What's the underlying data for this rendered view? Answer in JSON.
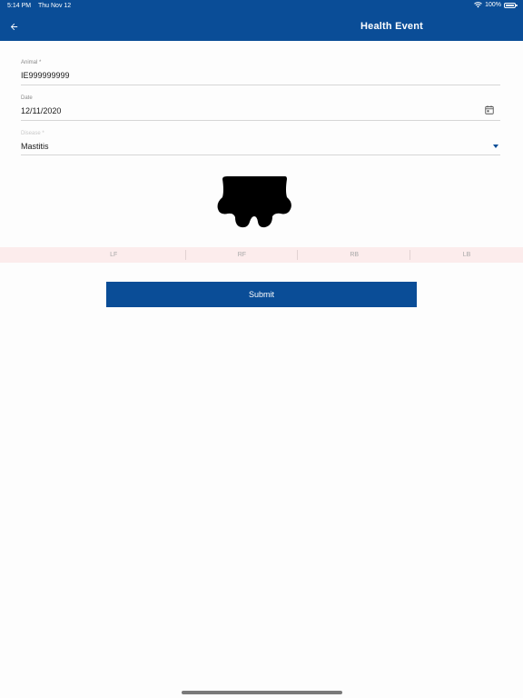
{
  "status_bar": {
    "time": "5:14 PM",
    "date": "Thu Nov 12",
    "battery": "100%",
    "wifi_icon": "wifi-icon",
    "battery_icon": "battery-icon"
  },
  "app_bar": {
    "title": "Health Event",
    "back_icon": "arrow-left-icon",
    "background_color": "#0a4d97"
  },
  "form": {
    "animal": {
      "label": "Animal *",
      "value": "IE999999999"
    },
    "date": {
      "label": "Date",
      "value": "12/11/2020",
      "icon": "calendar-icon"
    },
    "disease": {
      "label": "Disease *",
      "value": "Mastitis",
      "icon": "dropdown-arrow-icon"
    }
  },
  "udder": {
    "icon": "udder-icon"
  },
  "quarters": [
    {
      "label": "LF"
    },
    {
      "label": "RF"
    },
    {
      "label": "RB"
    },
    {
      "label": "LB"
    }
  ],
  "submit": {
    "label": "Submit"
  }
}
